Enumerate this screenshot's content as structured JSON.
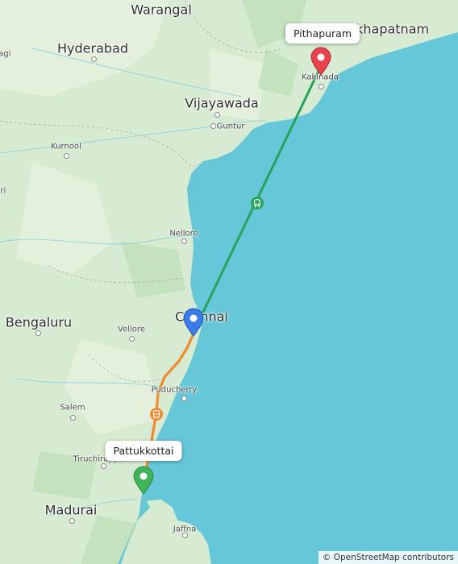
{
  "map": {
    "cities_large": [
      {
        "name": "Warangal"
      },
      {
        "name": "Hyderabad"
      },
      {
        "name": "Vijayawada"
      },
      {
        "name": "Bengaluru"
      },
      {
        "name": "Chennai"
      },
      {
        "name": "Madurai"
      },
      {
        "name": "Visakhapatnam"
      }
    ],
    "cities_small": [
      {
        "name": "Guntur"
      },
      {
        "name": "Kurnool"
      },
      {
        "name": "Nellore"
      },
      {
        "name": "Vellore"
      },
      {
        "name": "Puducherry"
      },
      {
        "name": "Salem"
      },
      {
        "name": "Tiruchirappalli"
      },
      {
        "name": "Kakinada"
      },
      {
        "name": "Jaffna"
      }
    ],
    "edge_fragments": [
      "ragi",
      "uri"
    ]
  },
  "route": {
    "origin": {
      "label": "Pattukkottai",
      "pin_color": "#3fb25a"
    },
    "destination": {
      "label": "Pithapuram",
      "pin_color": "#e8434f"
    },
    "waypoint": {
      "pin_color": "#3b7be8"
    },
    "bus_leg": {
      "color": "#ee8a2f",
      "icon": "bus-icon"
    },
    "train_leg": {
      "color": "#27a35b",
      "icon": "train-icon"
    }
  },
  "attribution": "© OpenStreetMap contributors"
}
